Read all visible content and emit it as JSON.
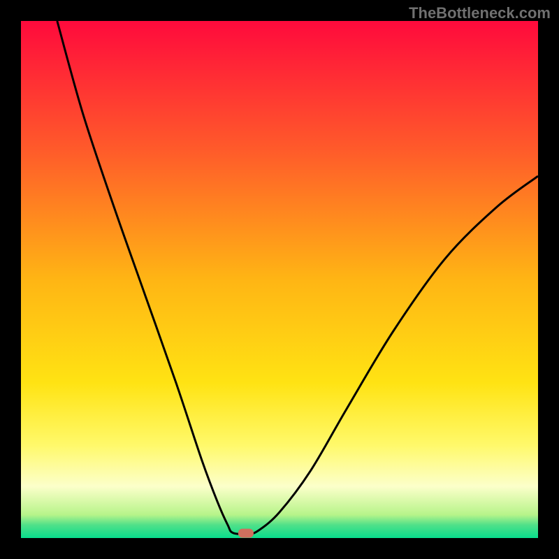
{
  "watermark": "TheBottleneck.com",
  "chart_data": {
    "type": "line",
    "title": "",
    "xlabel": "",
    "ylabel": "",
    "xlim": [
      0,
      100
    ],
    "ylim": [
      0,
      100
    ],
    "gradient_stops": [
      {
        "offset": 0.0,
        "color": "#ff0a3c"
      },
      {
        "offset": 0.25,
        "color": "#ff5b2a"
      },
      {
        "offset": 0.5,
        "color": "#ffb514"
      },
      {
        "offset": 0.7,
        "color": "#ffe313"
      },
      {
        "offset": 0.82,
        "color": "#fff96a"
      },
      {
        "offset": 0.9,
        "color": "#fcffca"
      },
      {
        "offset": 0.955,
        "color": "#b7f48a"
      },
      {
        "offset": 0.975,
        "color": "#4fe089"
      },
      {
        "offset": 1.0,
        "color": "#08dd8c"
      }
    ],
    "series": [
      {
        "name": "curve",
        "points": [
          {
            "x": 7,
            "y": 100
          },
          {
            "x": 12,
            "y": 82
          },
          {
            "x": 18,
            "y": 64
          },
          {
            "x": 24,
            "y": 47
          },
          {
            "x": 30,
            "y": 30
          },
          {
            "x": 35,
            "y": 15
          },
          {
            "x": 38,
            "y": 7
          },
          {
            "x": 40,
            "y": 2.5
          },
          {
            "x": 41,
            "y": 1.0
          },
          {
            "x": 44,
            "y": 0.8
          },
          {
            "x": 46,
            "y": 1.5
          },
          {
            "x": 50,
            "y": 5
          },
          {
            "x": 56,
            "y": 13
          },
          {
            "x": 63,
            "y": 25
          },
          {
            "x": 72,
            "y": 40
          },
          {
            "x": 82,
            "y": 54
          },
          {
            "x": 92,
            "y": 64
          },
          {
            "x": 100,
            "y": 70
          }
        ]
      }
    ],
    "marker": {
      "x": 43.5,
      "y": 1.0,
      "color": "#cf705e"
    }
  }
}
